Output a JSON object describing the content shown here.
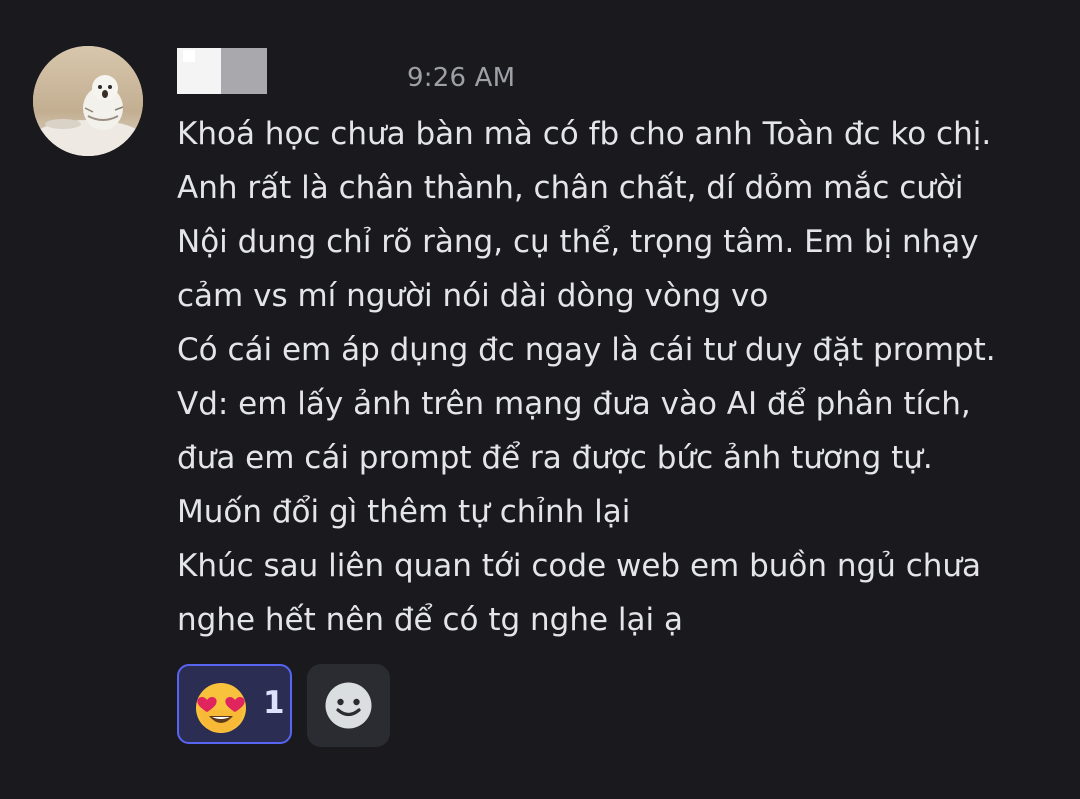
{
  "message": {
    "timestamp": "9:26 AM",
    "lines": [
      "Khoá học chưa bàn mà có fb cho anh Toàn đc ko chị.",
      "Anh rất là chân thành, chân chất, dí dỏm mắc cười",
      "Nội dung chỉ rõ ràng, cụ thể, trọng tâm. Em bị nhạy",
      "cảm vs mí người nói dài dòng vòng vo",
      "Có cái em áp dụng đc ngay là cái tư duy đặt prompt.",
      "Vd: em lấy ảnh trên mạng đưa vào AI để phân tích,",
      "đưa em cái prompt để ra được bức ảnh tương tự.",
      "Muốn đổi gì thêm tự chỉnh lại",
      "Khúc sau liên quan tới code web em buồn ngủ chưa",
      "nghe hết nên để có tg nghe lại ạ"
    ]
  },
  "reactions": [
    {
      "emoji": "heart-eyes-emoji",
      "count": "1",
      "selected": true
    }
  ],
  "add_reaction_icon": "smiley-face-icon",
  "colors": {
    "background": "#1a1a1e",
    "text": "#e3e5e8",
    "timestamp": "#9da0a6",
    "reaction_selected_border": "#5865f2",
    "reaction_selected_bg": "#2b2d52"
  }
}
